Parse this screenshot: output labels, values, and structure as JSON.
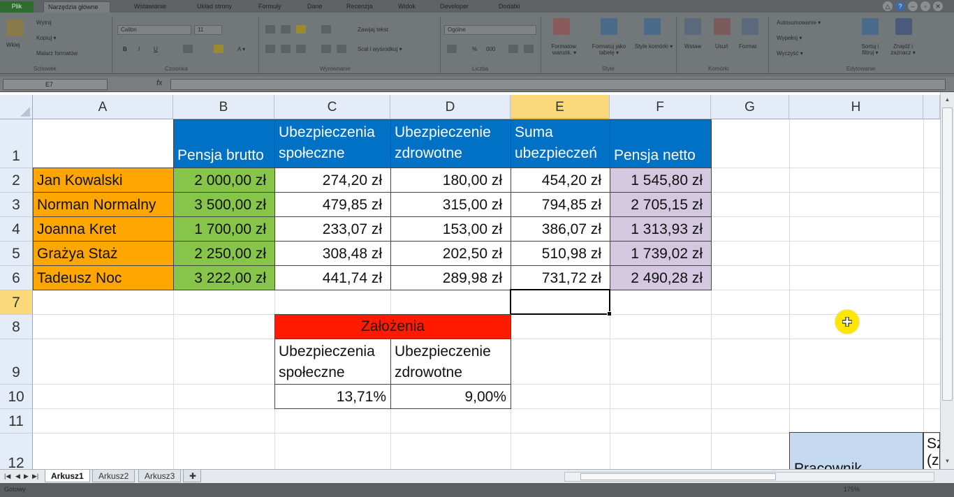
{
  "ribbon": {
    "tabs": [
      "Plik",
      "Narzędzia główne",
      "Wstawianie",
      "Układ strony",
      "Formuły",
      "Dane",
      "Recenzja",
      "Widok",
      "Developer",
      "Dodatki"
    ],
    "groups": {
      "clipboard": {
        "label": "Schowek",
        "paste": "Wklej",
        "cut": "Wytnij",
        "copy": "Kopiuj ▾",
        "format_painter": "Malarz formatów"
      },
      "font": {
        "label": "Czcionka",
        "font_name": "Calibri",
        "font_size": "11"
      },
      "alignment": {
        "label": "Wyrównanie",
        "wrap": "Zawijaj tekst",
        "merge": "Scal i wyśrodkuj ▾"
      },
      "number": {
        "label": "Liczba",
        "format": "Ogólne"
      },
      "styles": {
        "label": "Style",
        "cond_format": "Formatow. warunk. ▾",
        "format_table": "Formatuj jako tabelę ▾",
        "cell_styles": "Style komórki ▾"
      },
      "cells": {
        "label": "Komórki",
        "insert": "Wstaw",
        "delete": "Usuń",
        "format": "Format"
      },
      "editing": {
        "label": "Edytowanie",
        "autosum": "Autosumowanie ▾",
        "fill": "Wypełnij ▾",
        "clear": "Wyczyść ▾",
        "sort": "Sortuj i filtruj ▾",
        "find": "Znajdź i zaznacz ▾"
      }
    }
  },
  "formula_bar": {
    "name_box": "E7",
    "fx": "fx",
    "value": ""
  },
  "columns": [
    "A",
    "B",
    "C",
    "D",
    "E",
    "F",
    "G",
    "H"
  ],
  "rows": [
    "1",
    "2",
    "3",
    "4",
    "5",
    "6",
    "7",
    "8",
    "9",
    "10",
    "11",
    "12"
  ],
  "table": {
    "headers": {
      "b": "Pensja brutto",
      "c1": "Ubezpieczenia",
      "c2": "społeczne",
      "d1": "Ubezpieczenie",
      "d2": "zdrowotne",
      "e1": "Suma",
      "e2": "ubezpieczeń",
      "f": "Pensja netto"
    },
    "rows": [
      {
        "name": "Jan Kowalski",
        "brutto": "2 000,00 zł",
        "spoleczne": "274,20 zł",
        "zdrowotne": "180,00 zł",
        "suma": "454,20 zł",
        "netto": "1 545,80 zł"
      },
      {
        "name": "Norman Normalny",
        "brutto": "3 500,00 zł",
        "spoleczne": "479,85 zł",
        "zdrowotne": "315,00 zł",
        "suma": "794,85 zł",
        "netto": "2 705,15 zł"
      },
      {
        "name": "Joanna Kret",
        "brutto": "1 700,00 zł",
        "spoleczne": "233,07 zł",
        "zdrowotne": "153,00 zł",
        "suma": "386,07 zł",
        "netto": "1 313,93 zł"
      },
      {
        "name": "Grażya Staż",
        "brutto": "2 250,00 zł",
        "spoleczne": "308,48 zł",
        "zdrowotne": "202,50 zł",
        "suma": "510,98 zł",
        "netto": "1 739,02 zł"
      },
      {
        "name": "Tadeusz Noc",
        "brutto": "3 222,00 zł",
        "spoleczne": "441,74 zł",
        "zdrowotne": "289,98 zł",
        "suma": "731,72 zł",
        "netto": "2 490,28 zł"
      }
    ]
  },
  "assumptions": {
    "title": "Założenia",
    "c1": "Ubezpieczenia",
    "c2": "społeczne",
    "d1": "Ubezpieczenie",
    "d2": "zdrowotne",
    "c_value": "13,71%",
    "d_value": "9,00%"
  },
  "partial": {
    "pracownik": "Pracownik",
    "sz": "Sz (z"
  },
  "sheets": [
    "Arkusz1",
    "Arkusz2",
    "Arkusz3"
  ],
  "status": {
    "ready": "Gotowy",
    "zoom": "175%"
  },
  "colors": {
    "header_blue": "#0071c5",
    "name_orange": "#ffa600",
    "brutto_green": "#86c44a",
    "netto_lavender": "#d3c8e0",
    "assumption_red": "#ff1a00",
    "selected_header": "#f9d97a"
  }
}
